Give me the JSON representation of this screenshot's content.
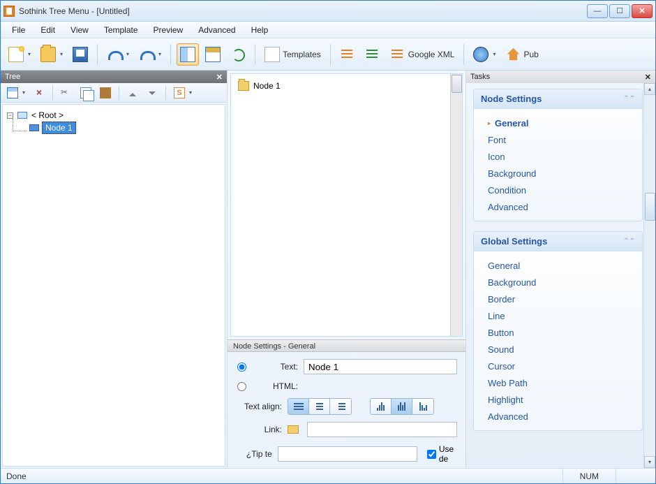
{
  "title": "Sothink Tree Menu - [Untitled]",
  "menu": [
    "File",
    "Edit",
    "View",
    "Template",
    "Preview",
    "Advanced",
    "Help"
  ],
  "toolbar": {
    "templates": "Templates",
    "googlexml": "Google XML",
    "publish": "Pub"
  },
  "treepanel": {
    "title": "Tree"
  },
  "tree": {
    "root": "< Root >",
    "node1": "Node 1"
  },
  "preview": {
    "node1": "Node 1"
  },
  "node_settings": {
    "panel_title": "Node Settings - General",
    "text_label": "Text:",
    "text_value": "Node 1",
    "html_label": "HTML:",
    "align_label": "Text align:",
    "link_label": "Link:",
    "tip_label": "¿Tip te",
    "use_de": "Use de"
  },
  "tasks": {
    "title": "Tasks",
    "node": {
      "title": "Node Settings",
      "items": [
        "General",
        "Font",
        "Icon",
        "Background",
        "Condition",
        "Advanced"
      ]
    },
    "global": {
      "title": "Global Settings",
      "items": [
        "General",
        "Background",
        "Border",
        "Line",
        "Button",
        "Sound",
        "Cursor",
        "Web Path",
        "Highlight",
        "Advanced"
      ]
    }
  },
  "status": {
    "done": "Done",
    "num": "NUM"
  }
}
